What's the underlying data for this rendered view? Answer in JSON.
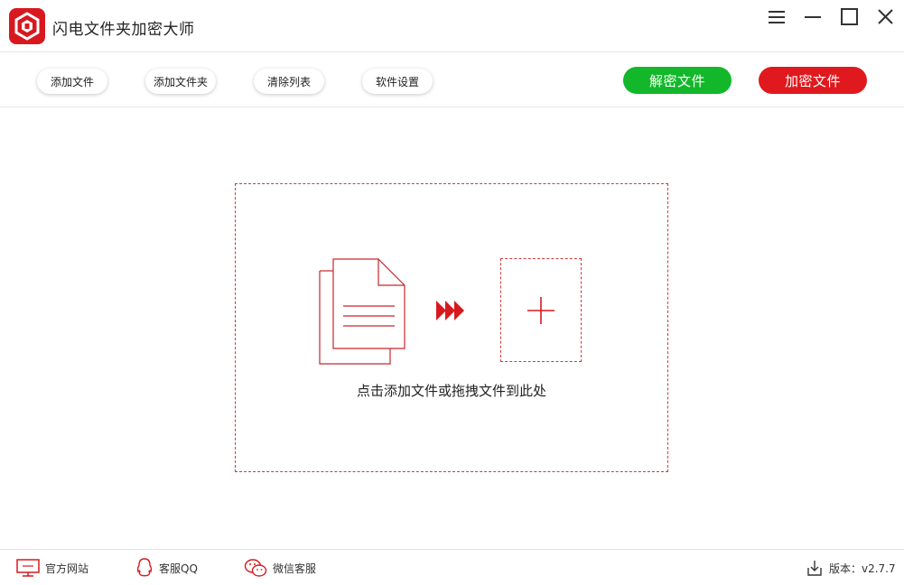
{
  "app": {
    "title": "闪电文件夹加密大师"
  },
  "toolbar": {
    "add_file": "添加文件",
    "add_folder": "添加文件夹",
    "clear_list": "清除列表",
    "settings": "软件设置",
    "decrypt": "解密文件",
    "encrypt": "加密文件"
  },
  "dropzone": {
    "hint": "点击添加文件或拖拽文件到此处"
  },
  "footer": {
    "official_site": "官方网站",
    "qq_support": "客服QQ",
    "wechat_support": "微信客服",
    "version": "版本：v2.7.7"
  },
  "icons": {
    "logo": "shield-logo-icon",
    "menu": "menu-icon",
    "minimize": "minimize-icon",
    "maximize": "maximize-icon",
    "close": "close-icon",
    "document": "document-stack-icon",
    "arrows": "triple-arrow-icon",
    "plus": "plus-icon",
    "monitor": "monitor-icon",
    "qq": "qq-penguin-icon",
    "wechat": "wechat-icon",
    "download": "download-icon"
  },
  "colors": {
    "accent_red": "#e0191e",
    "accent_green": "#13b82a",
    "dashed_border": "#d23a3a"
  }
}
